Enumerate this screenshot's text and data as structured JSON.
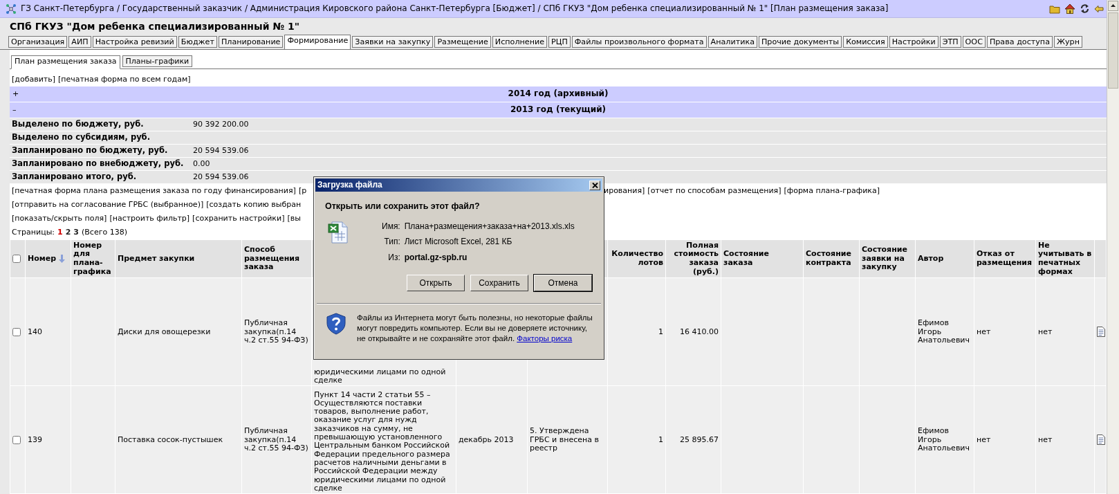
{
  "title_bar": {
    "breadcrumb": "ГЗ Санкт-Петербурга / Государственный заказчик / Администрация Кировского района Санкт-Петербурга [Бюджет] / СПб ГКУЗ \"Дом ребенка специализированный № 1\" [План размещения заказа]"
  },
  "org_title": "СПб ГКУЗ \"Дом ребенка специализированный № 1\"",
  "tabs": [
    {
      "label": "Организация",
      "selected": false
    },
    {
      "label": "АИП",
      "selected": false
    },
    {
      "label": "Настройка ревизий",
      "selected": false
    },
    {
      "label": "Бюджет",
      "selected": false
    },
    {
      "label": "Планирование",
      "selected": false
    },
    {
      "label": "Формирование",
      "selected": true
    },
    {
      "label": "Заявки на закупку",
      "selected": false
    },
    {
      "label": "Размещение",
      "selected": false
    },
    {
      "label": "Исполнение",
      "selected": false
    },
    {
      "label": "РЦП",
      "selected": false
    },
    {
      "label": "Файлы произвольного формата",
      "selected": false
    },
    {
      "label": "Аналитика",
      "selected": false
    },
    {
      "label": "Прочие документы",
      "selected": false
    },
    {
      "label": "Комиссия",
      "selected": false
    },
    {
      "label": "Настройки",
      "selected": false
    },
    {
      "label": "ЭТП",
      "selected": false
    },
    {
      "label": "ООС",
      "selected": false
    },
    {
      "label": "Права доступа",
      "selected": false
    },
    {
      "label": "Журн",
      "selected": false
    }
  ],
  "subtabs": [
    {
      "label": "План размещения заказа",
      "selected": true
    },
    {
      "label": "Планы-графики",
      "selected": false
    }
  ],
  "top_links": [
    "[добавить]",
    "[печатная форма по всем годам]"
  ],
  "years": [
    {
      "toggle": "+",
      "label": "2014 год (архивный)"
    },
    {
      "toggle": "–",
      "label": "2013 год (текущий)",
      "summary": [
        {
          "label": "Выделено по бюджету, руб.",
          "value": "90 392 200.00"
        },
        {
          "label": "Выделено по субсидиям, руб."
        },
        {
          "label": "Запланировано по бюджету, руб.",
          "value": "20 594 539.06"
        },
        {
          "label": "Запланировано по внебюджету, руб.",
          "value": "0.00"
        },
        {
          "label": "Запланировано итого, руб.",
          "value": "20 594 539.06"
        }
      ]
    }
  ],
  "action_lines": [
    {
      "left": [
        "[печатная форма плана размещения заказа по году финансирования]",
        "[р"
      ],
      "right": [
        "ирования]",
        "[отчет по способам размещения]",
        "[форма плана-графика]"
      ]
    },
    {
      "left": [
        "[отправить на согласование ГРБС (выбранное)]",
        "[создать копию выбран"
      ]
    },
    {
      "left": [
        "[показать/скрыть поля]",
        "[настроить фильтр]",
        "[сохранить настройки]",
        "[вы"
      ]
    }
  ],
  "pagination": {
    "label": "Страницы:",
    "pages": [
      {
        "label": "1",
        "selected": true
      },
      {
        "label": "2",
        "selected": false
      },
      {
        "label": "3",
        "selected": false
      }
    ],
    "total": "(Всего 138)"
  },
  "table": {
    "select_all_checked": false,
    "columns": [
      {
        "label": "Номер",
        "kind": "text",
        "sorted": true
      },
      {
        "label": "Номер для плана-графика",
        "kind": "text"
      },
      {
        "label": "Предмет закупки",
        "kind": "text"
      },
      {
        "label": "Способ размещения заказа",
        "kind": "text"
      },
      {
        "kind": "long"
      },
      {
        "kind": "text"
      },
      {
        "kind": "text"
      },
      {
        "label": "Количество лотов",
        "kind": "number"
      },
      {
        "label": "Полная стоимость заказа (руб.)",
        "kind": "number"
      },
      {
        "label": "Состояние заказа",
        "kind": "text"
      },
      {
        "label": "Состояние контракта",
        "kind": "text"
      },
      {
        "label": "Состояние заявки на закупку",
        "kind": "text"
      },
      {
        "label": "Автор",
        "kind": "text"
      },
      {
        "label": "Отказ от размещения",
        "kind": "text"
      },
      {
        "label": "Не учитывать в печатных формах",
        "kind": "text"
      }
    ],
    "rows": [
      {
        "checked": false,
        "cells": [
          "140",
          null,
          "Диски для овощерезки",
          "Публичная закупка(п.14 ч.2 ст.55 94-ФЗ)",
          "юридическими лицами по одной сделке",
          null,
          null,
          "1",
          "16 410.00",
          null,
          null,
          null,
          "Ефимов Игорь Анатольевич",
          "нет",
          "нет"
        ]
      },
      {
        "checked": false,
        "cells": [
          "139",
          null,
          "Поставка сосок-пустышек",
          "Публичная закупка(п.14 ч.2 ст.55 94-ФЗ)",
          "Пункт 14 части 2 статьи 55 – Осуществляются поставки товаров, выполнение работ, оказание услуг для нужд заказчиков на сумму, не превышающую установленного Центральным банком Российской Федерации предельного размера расчетов наличными деньгами в Российской Федерации между юридическими лицами по одной сделке",
          "декабрь 2013",
          "5. Утверждена ГРБС и внесена в реестр",
          "1",
          "25 895.67",
          null,
          null,
          null,
          "Ефимов Игорь Анатольевич",
          "нет",
          "нет"
        ]
      }
    ]
  },
  "dialog": {
    "title": "Загрузка файла",
    "question": "Открыть или сохранить этот файл?",
    "fields": [
      {
        "label": "Имя:",
        "value": "Плана+размещения+заказа+на+2013.xls.xls",
        "bold": false
      },
      {
        "label": "Тип:",
        "value": "Лист Microsoft Excel, 281 КБ",
        "bold": false
      },
      {
        "label": "Из:",
        "value": "portal.gz-spb.ru",
        "bold": true
      }
    ],
    "buttons": [
      {
        "label": "Открыть",
        "default": false
      },
      {
        "label": "Сохранить",
        "default": false
      },
      {
        "label": "Отмена",
        "default": true
      }
    ],
    "warning": "Файлы из Интернета могут быть полезны, но некоторые файлы могут повредить компьютер. Если вы не доверяете источнику, не открывайте и не сохраняйте этот файл.",
    "link": "Факторы риска"
  }
}
